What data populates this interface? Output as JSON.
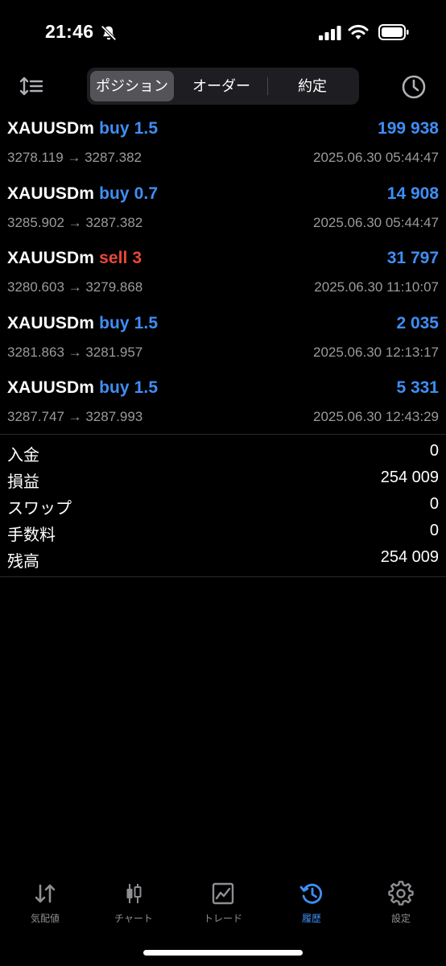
{
  "status_bar": {
    "time": "21:46",
    "icons": [
      "bell-muted-icon",
      "cellular-signal-icon",
      "wifi-icon",
      "battery-icon"
    ]
  },
  "toolbar": {
    "sort_icon": "sort-icon",
    "history_icon": "clock-icon",
    "tabs": [
      {
        "label": "ポジション",
        "selected": true
      },
      {
        "label": "オーダー",
        "selected": false
      },
      {
        "label": "約定",
        "selected": false
      }
    ]
  },
  "deals": [
    {
      "symbol": "XAUUSDm",
      "side": "buy 1.5",
      "side_type": "buy",
      "profit": "199 938",
      "prices": "3278.119 → 3287.382",
      "time": "2025.06.30 05:44:47"
    },
    {
      "symbol": "XAUUSDm",
      "side": "buy 0.7",
      "side_type": "buy",
      "profit": "14 908",
      "prices": "3285.902 → 3287.382",
      "time": "2025.06.30 05:44:47"
    },
    {
      "symbol": "XAUUSDm",
      "side": "sell 3",
      "side_type": "sell",
      "profit": "31 797",
      "prices": "3280.603 → 3279.868",
      "time": "2025.06.30 11:10:07"
    },
    {
      "symbol": "XAUUSDm",
      "side": "buy 1.5",
      "side_type": "buy",
      "profit": "2 035",
      "prices": "3281.863 → 3281.957",
      "time": "2025.06.30 12:13:17"
    },
    {
      "symbol": "XAUUSDm",
      "side": "buy 1.5",
      "side_type": "buy",
      "profit": "5 331",
      "prices": "3287.747 → 3287.993",
      "time": "2025.06.30 12:43:29"
    }
  ],
  "summary": [
    {
      "label": "入金",
      "value": "0"
    },
    {
      "label": "損益",
      "value": "254 009"
    },
    {
      "label": "スワップ",
      "value": "0"
    },
    {
      "label": "手数料",
      "value": "0"
    },
    {
      "label": "残高",
      "value": "254 009"
    }
  ],
  "tabbar": [
    {
      "label": "気配値",
      "icon": "quotes-arrows-icon",
      "active": false
    },
    {
      "label": "チャート",
      "icon": "candlestick-chart-icon",
      "active": false
    },
    {
      "label": "トレード",
      "icon": "trade-chart-icon",
      "active": false
    },
    {
      "label": "履歴",
      "icon": "history-icon",
      "active": true
    },
    {
      "label": "設定",
      "icon": "gear-icon",
      "active": false
    }
  ],
  "colors": {
    "background": "#000000",
    "accent_blue": "#3f8ef5",
    "sell_red": "#e9473b",
    "secondary_text": "#9a9aa0",
    "segment_bg": "#1e1e22",
    "segment_selected": "#535358"
  }
}
